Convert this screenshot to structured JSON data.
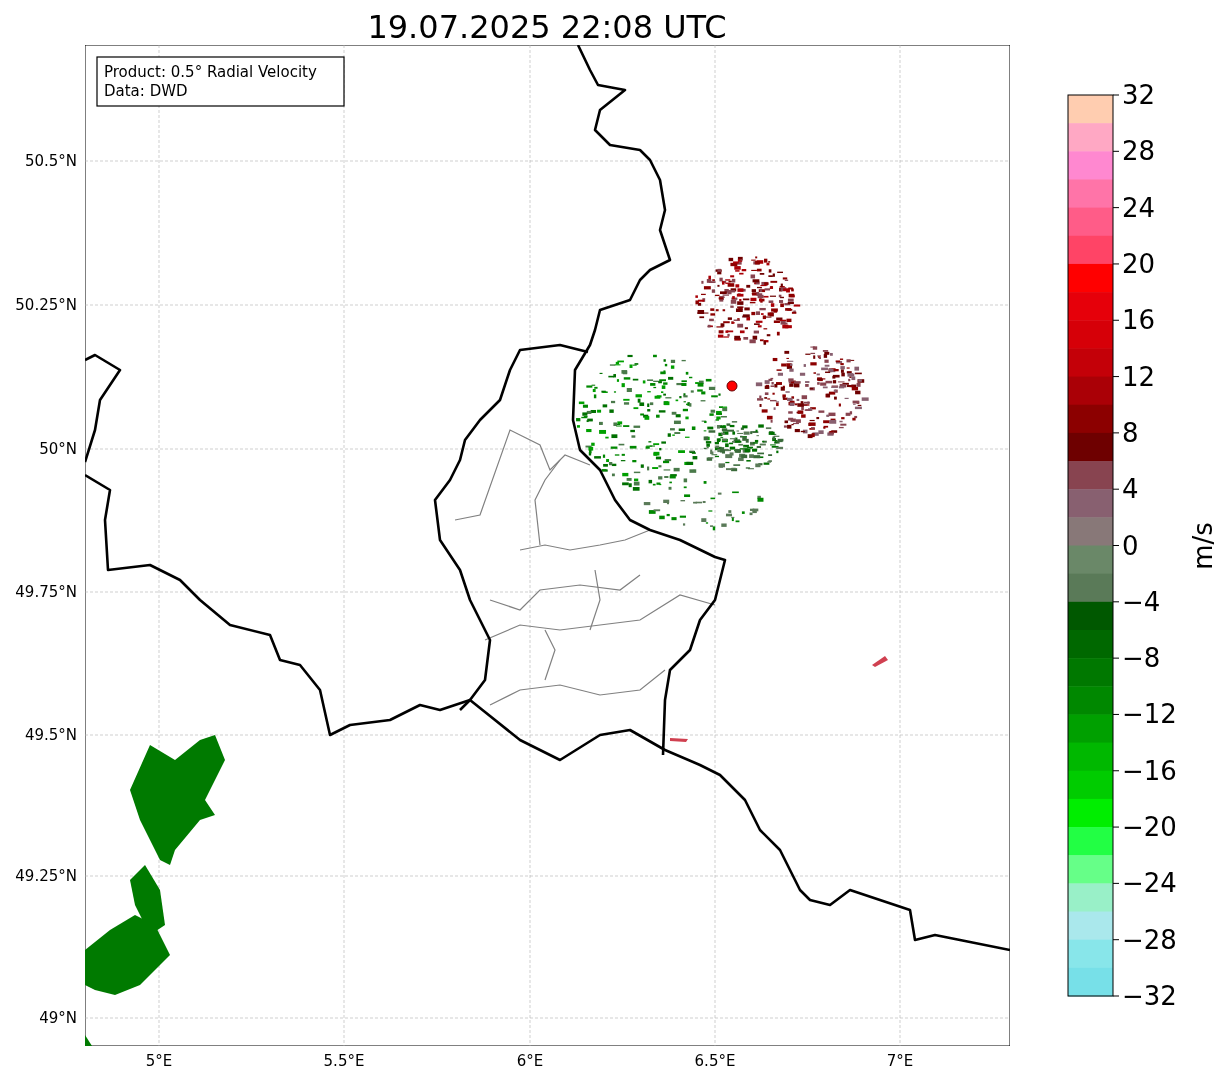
{
  "title": "19.07.2025 22:08 UTC",
  "info_box": {
    "lines": [
      "Product: 0.5° Radial Velocity",
      "Data: DWD"
    ]
  },
  "map": {
    "xticks": [
      "5°E",
      "5.5°E",
      "6°E",
      "6.5°E",
      "7°E"
    ],
    "yticks": [
      "50.5°N",
      "50.25°N",
      "50°N",
      "49.75°N",
      "49.5°N",
      "49.25°N",
      "49°N"
    ]
  },
  "colorbar": {
    "label": "m/s",
    "ticks": [
      "32",
      "28",
      "24",
      "20",
      "16",
      "12",
      "8",
      "4",
      "0",
      "−4",
      "−8",
      "−12",
      "−16",
      "−20",
      "−24",
      "−28",
      "−32"
    ],
    "bins": [
      {
        "color": "#ffcdb0"
      },
      {
        "color": "#ffa8c4"
      },
      {
        "color": "#ff88d0"
      },
      {
        "color": "#ff74a8"
      },
      {
        "color": "#ff5c88"
      },
      {
        "color": "#ff4466"
      },
      {
        "color": "#ff0000"
      },
      {
        "color": "#e6000a"
      },
      {
        "color": "#d60008"
      },
      {
        "color": "#c40008"
      },
      {
        "color": "#aa0006"
      },
      {
        "color": "#8c0000"
      },
      {
        "color": "#6e0000"
      },
      {
        "color": "#884450"
      },
      {
        "color": "#886070"
      },
      {
        "color": "#887878"
      },
      {
        "color": "#6a8868"
      },
      {
        "color": "#5a7a58"
      },
      {
        "color": "#005800"
      },
      {
        "color": "#006800"
      },
      {
        "color": "#007800"
      },
      {
        "color": "#008800"
      },
      {
        "color": "#00a000"
      },
      {
        "color": "#00b800"
      },
      {
        "color": "#00cc00"
      },
      {
        "color": "#00ee00"
      },
      {
        "color": "#22ff44"
      },
      {
        "color": "#66ff88"
      },
      {
        "color": "#99f0c8"
      },
      {
        "color": "#aae8ec"
      },
      {
        "color": "#88e6ea"
      },
      {
        "color": "#77e0e8"
      }
    ]
  }
}
